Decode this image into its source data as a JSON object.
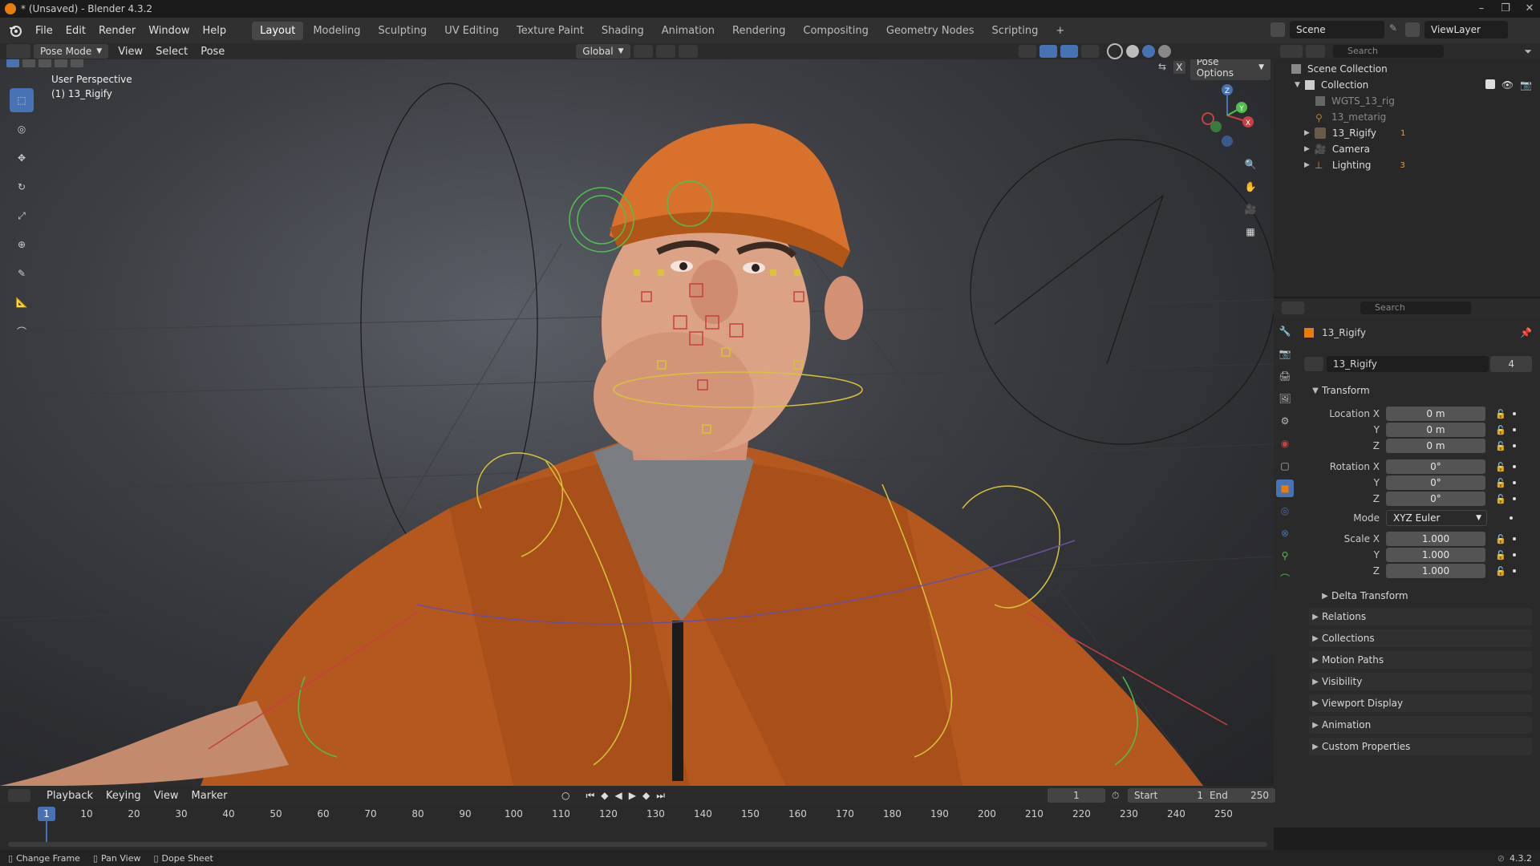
{
  "window": {
    "title": "* (Unsaved) - Blender 4.3.2"
  },
  "menu": [
    "File",
    "Edit",
    "Render",
    "Window",
    "Help"
  ],
  "workspaces": [
    {
      "label": "Layout",
      "active": true
    },
    {
      "label": "Modeling"
    },
    {
      "label": "Sculpting"
    },
    {
      "label": "UV Editing"
    },
    {
      "label": "Texture Paint"
    },
    {
      "label": "Shading"
    },
    {
      "label": "Animation"
    },
    {
      "label": "Rendering"
    },
    {
      "label": "Compositing"
    },
    {
      "label": "Geometry Nodes"
    },
    {
      "label": "Scripting"
    }
  ],
  "add_workspace": "+",
  "scene": {
    "name": "Scene",
    "view_layer": "ViewLayer"
  },
  "viewport_header": {
    "mode": "Pose Mode",
    "menus": [
      "View",
      "Select",
      "Pose"
    ],
    "orientation": "Global",
    "pose_options": "Pose Options"
  },
  "viewport": {
    "perspective": "User Perspective",
    "object_label": "(1) 13_Rigify",
    "gizmo": {
      "x": "X",
      "y": "Y",
      "z": "Z"
    },
    "accent": "#4772b3"
  },
  "outliner": {
    "search_placeholder": "Search",
    "items": [
      {
        "label": "Scene Collection"
      },
      {
        "label": "Collection"
      },
      {
        "label": "WGTS_13_rig"
      },
      {
        "label": "13_metarig"
      },
      {
        "label": "13_Rigify"
      },
      {
        "label": "Camera"
      },
      {
        "label": "Lighting"
      }
    ],
    "badges": {
      "rigify": "1",
      "lighting": "3"
    }
  },
  "properties": {
    "search_placeholder": "Search",
    "context_object": "13_Rigify",
    "data_name": "13_Rigify",
    "users": "4",
    "transform": {
      "header": "Transform",
      "location_label": "Location X",
      "location": [
        "0 m",
        "0 m",
        "0 m"
      ],
      "rotation_label": "Rotation X",
      "rotation": [
        "0°",
        "0°",
        "0°"
      ],
      "mode_label": "Mode",
      "mode": "XYZ Euler",
      "scale_label": "Scale X",
      "scale": [
        "1.000",
        "1.000",
        "1.000"
      ],
      "axis_y": "Y",
      "axis_z": "Z"
    },
    "subpanel": "Delta Transform",
    "panels": [
      "Relations",
      "Collections",
      "Motion Paths",
      "Visibility",
      "Viewport Display",
      "Animation",
      "Custom Properties"
    ]
  },
  "timeline": {
    "menus": [
      "Playback",
      "Keying",
      "View",
      "Marker"
    ],
    "current_frame": "1",
    "start_label": "Start",
    "start": "1",
    "end_label": "End",
    "end": "250",
    "ticks": [
      "1",
      "10",
      "20",
      "30",
      "40",
      "50",
      "60",
      "70",
      "80",
      "90",
      "100",
      "110",
      "120",
      "130",
      "140",
      "150",
      "160",
      "170",
      "180",
      "190",
      "200",
      "210",
      "220",
      "230",
      "240",
      "250"
    ]
  },
  "statusbar": {
    "hints": [
      "Change Frame",
      "Pan View",
      "Dope Sheet"
    ],
    "version": "4.3.2"
  },
  "colors": {
    "accent": "#4772b3",
    "orange": "#e87d0d",
    "rig_yellow": "#d8c23a",
    "rig_green": "#4fbf4f",
    "rig_red": "#c84040"
  }
}
